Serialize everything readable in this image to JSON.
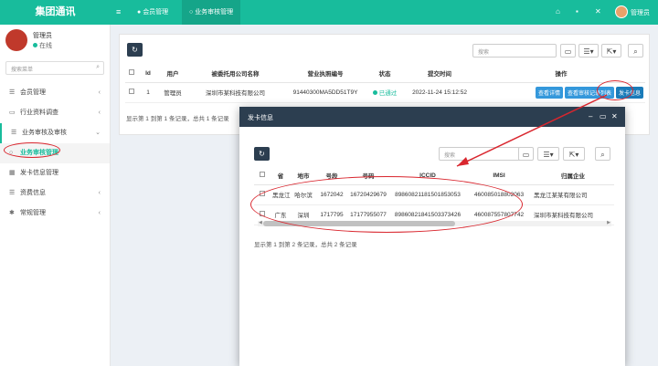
{
  "app": {
    "brand": "集团通讯"
  },
  "topnav": {
    "tabs": [
      {
        "label": "会员管理"
      },
      {
        "label": "业务审核管理"
      }
    ],
    "user": "管理员"
  },
  "sidebar": {
    "profile": {
      "name": "管理员",
      "status": "在线"
    },
    "search_placeholder": "搜索菜单",
    "menu": [
      {
        "label": "会员管理"
      },
      {
        "label": "行业资料调查"
      },
      {
        "label": "业务审核及审核"
      },
      {
        "label": "业务审核管理"
      },
      {
        "label": "发卡信息管理"
      },
      {
        "label": "资费信息"
      },
      {
        "label": "常规管理"
      }
    ]
  },
  "main": {
    "search_placeholder": "搜索",
    "columns": [
      "Id",
      "用户",
      "被委托用公司名称",
      "营业执照编号",
      "状态",
      "提交时间",
      "操作"
    ],
    "rows": [
      {
        "id": "1",
        "user": "管理员",
        "company": "深圳市某科技有限公司",
        "license": "91440300MA5DD51T9Y",
        "status": "已通过",
        "time": "2022-11-24 15:12:52"
      }
    ],
    "actions": [
      "查看详情",
      "查看审核记录列表",
      "发卡信息"
    ],
    "footer": "显示第 1 到第 1 条记录，总共 1 条记录"
  },
  "modal": {
    "title": "发卡信息",
    "search_placeholder": "搜索",
    "columns": [
      "省",
      "地市",
      "号段",
      "号码",
      "ICCID",
      "IMSI",
      "归属企业"
    ],
    "rows": [
      {
        "province": "黑龙江",
        "city": "哈尔滨",
        "segment": "1672042",
        "number": "16720429679",
        "iccid": "89860821181501853053",
        "imsi": "460085018802063",
        "company": "黑龙江某某有限公司"
      },
      {
        "province": "广东",
        "city": "深圳",
        "segment": "1717795",
        "number": "17177955077",
        "iccid": "89860821841503373426",
        "imsi": "460087557807742",
        "company": "深圳市某科技有限公司"
      }
    ],
    "footer": "显示第 1 到第 2 条记录，总共 2 条记录"
  },
  "icons": {
    "menu": "hamburger-icon",
    "home": "home-icon",
    "trash": "trash-icon",
    "expand": "expand-icon",
    "refresh": "refresh-icon",
    "search": "search-icon"
  },
  "colors": {
    "accent": "#18bc9c",
    "dark": "#2c3e50",
    "annotation": "#d9262e"
  }
}
